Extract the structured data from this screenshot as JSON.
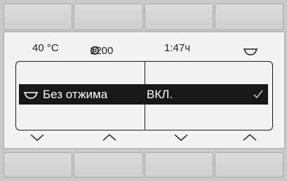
{
  "status": {
    "temperature": "40 °C",
    "spin_speed": "1200",
    "spin_glyph": "⚓",
    "duration": "1:47ч",
    "basin_icon": "basin-icon"
  },
  "options": {
    "left": {
      "label": "Без отжима",
      "icon": "basin-icon"
    },
    "right": {
      "label": "ВКЛ.",
      "icon": "check-icon"
    }
  },
  "controls": {
    "left_down": "chevron-down-icon",
    "left_up": "chevron-up-icon",
    "right_down": "chevron-down-icon",
    "right_up": "chevron-up-icon"
  },
  "colors": {
    "selected_bg": "#181818",
    "selected_text": "#ffffff",
    "screen_bg": "#f3f3f3"
  }
}
